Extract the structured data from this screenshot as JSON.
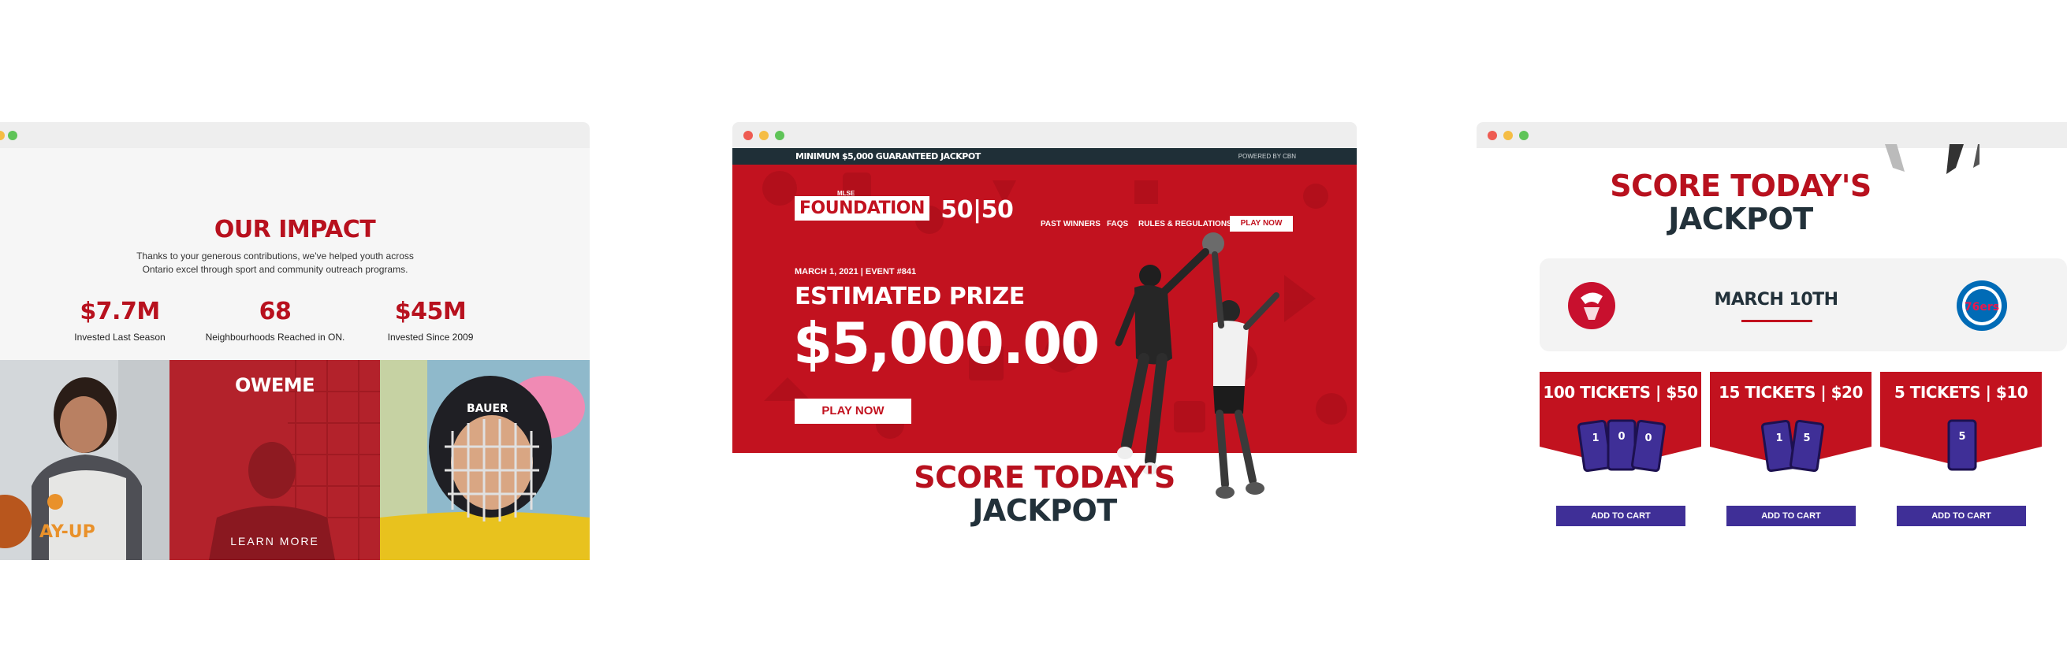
{
  "win1": {
    "title": "OUR IMPACT",
    "text": "Thanks to your generous contributions, we've helped youth across Ontario excel through sport and community outreach programs.",
    "stats": [
      {
        "value": "$7.7M",
        "label": "Invested Last Season"
      },
      {
        "value": "68",
        "label": "Neighbourhoods Reached in ON."
      },
      {
        "value": "$45M",
        "label": "Invested Since 2009"
      }
    ],
    "photo1_text": "AY-UP",
    "photo2_title": "OWEME",
    "photo2_cta": "LEARN MORE",
    "helmet_brand": "BAUER"
  },
  "win2": {
    "topbar_left": "MINIMUM $5,000 GUARANTEED JACKPOT",
    "topbar_right": "POWERED BY CBN",
    "logo_small": "MLSE",
    "logo_box": "FOUNDATION",
    "logo_num": "50|50",
    "nav": [
      "PAST WINNERS",
      "FAQS",
      "RULES & REGULATIONS"
    ],
    "nav_play": "PLAY NOW",
    "event": "MARCH 1, 2021 | EVENT #841",
    "est_label": "ESTIMATED PRIZE",
    "amount": "$5,000.00",
    "play": "PLAY NOW",
    "score_l1": "SCORE TODAY'S",
    "score_l2": "JACKPOT"
  },
  "win3": {
    "score_l1": "SCORE TODAY'S",
    "score_l2": "JACKPOT",
    "date": "MARCH 10TH",
    "tickets": [
      {
        "label": "100 TICKETS | $50",
        "cart": "ADD TO CART",
        "nums": [
          "1",
          "0",
          "0"
        ]
      },
      {
        "label": "15 TICKETS | $20",
        "cart": "ADD TO CART",
        "nums": [
          "1",
          "5"
        ]
      },
      {
        "label": "5 TICKETS | $10",
        "cart": "ADD TO CART",
        "nums": [
          "5"
        ]
      }
    ],
    "sixers_text": "76ers"
  },
  "colors": {
    "brand_red": "#c2121f",
    "dark_navy": "#22313a",
    "ticket_purple": "#3f2f97"
  }
}
